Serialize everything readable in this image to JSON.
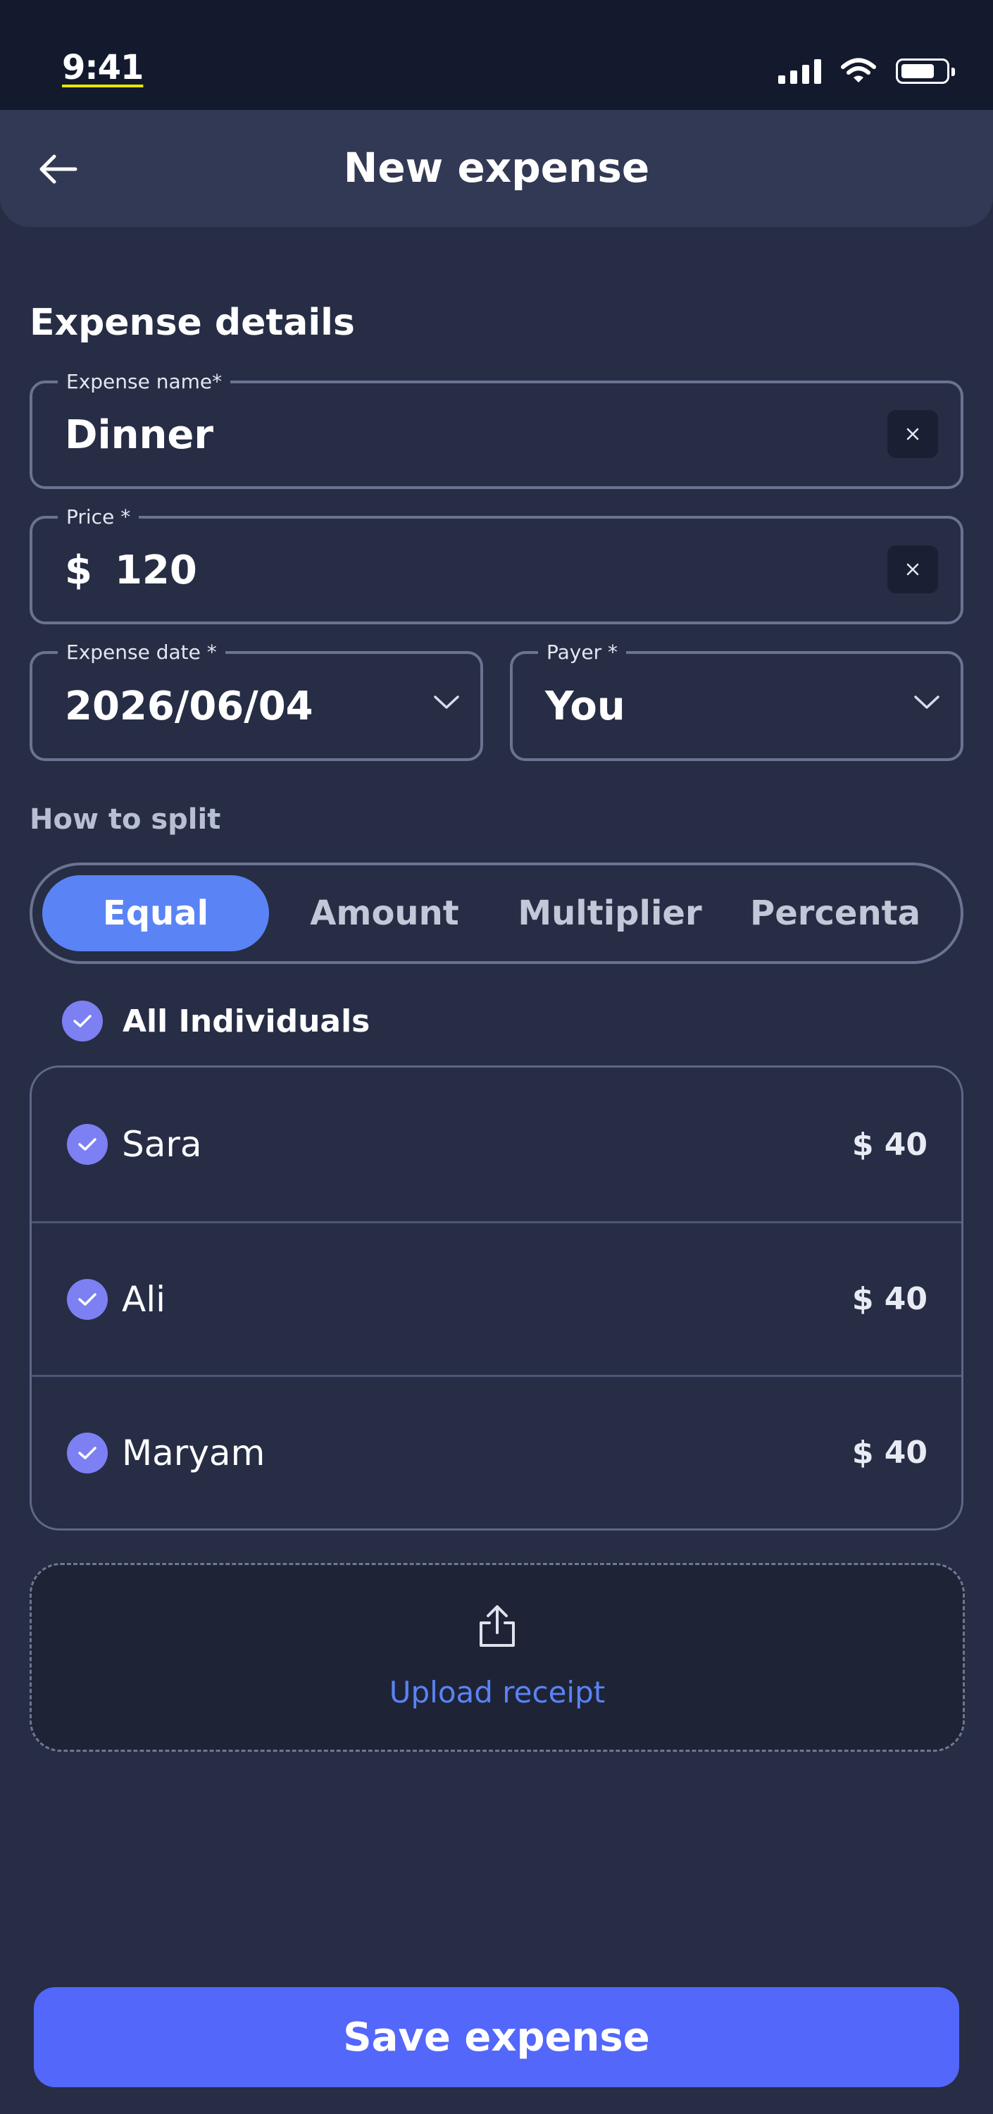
{
  "status_bar": {
    "time": "9:41"
  },
  "header": {
    "title": "New expense"
  },
  "expense_details": {
    "section_title": "Expense details",
    "name": {
      "label": "Expense name*",
      "value": "Dinner"
    },
    "price": {
      "label": "Price *",
      "currency": "$",
      "value": "120"
    },
    "date": {
      "label": "Expense date *",
      "value": "2026/06/04"
    },
    "payer": {
      "label": "Payer *",
      "value": "You"
    }
  },
  "split": {
    "title": "How to split",
    "tabs": [
      "Equal",
      "Amount",
      "Multiplier",
      "Percenta"
    ],
    "active_tab": "Equal",
    "all_label": "All Individuals",
    "people": [
      {
        "name": "Sara",
        "amount": "$ 40",
        "checked": true
      },
      {
        "name": "Ali",
        "amount": "$ 40",
        "checked": true
      },
      {
        "name": "Maryam",
        "amount": "$ 40",
        "checked": true
      }
    ]
  },
  "upload": {
    "label": "Upload receipt"
  },
  "actions": {
    "save_label": "Save expense"
  },
  "colors": {
    "background": "#262d45",
    "accent": "#5367fb",
    "check": "#7d80f2",
    "tab_active": "#5a84f5"
  }
}
